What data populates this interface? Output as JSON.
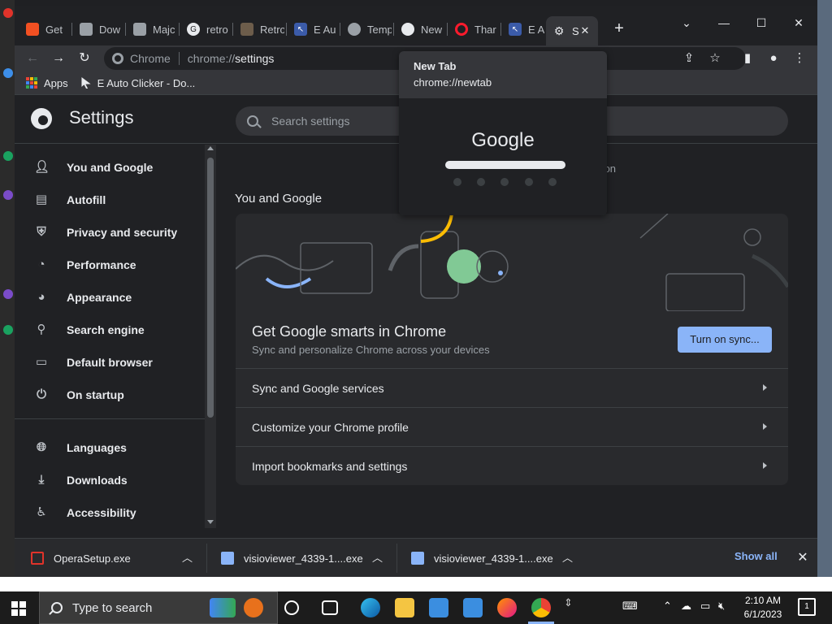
{
  "browser": {
    "tabs": [
      {
        "label": "Get",
        "color": "#f25022"
      },
      {
        "label": "Dow",
        "color": "#9aa0a6"
      },
      {
        "label": "Majc",
        "color": "#9aa0a6"
      },
      {
        "label": "retro",
        "color": "#e8eaed"
      },
      {
        "label": "Retro",
        "color": "#6d5d4b"
      },
      {
        "label": "E Au",
        "color": "#3b5ba9"
      },
      {
        "label": "Temp",
        "color": "#9aa0a6"
      },
      {
        "label": "New",
        "color": "#e8eaed"
      },
      {
        "label": "Thar",
        "color": "#ff1b2d"
      },
      {
        "label": "E Au",
        "color": "#3b5ba9"
      },
      {
        "label": "S",
        "color": "#e8eaed"
      }
    ],
    "omnibox": {
      "scheme_label": "Chrome",
      "url_prefix": "chrome://",
      "url_path": "settings"
    },
    "bookmarks": [
      {
        "label": "Apps"
      },
      {
        "label": "E Auto Clicker - Do..."
      }
    ],
    "hover_card": {
      "title": "New Tab",
      "url": "chrome://newtab",
      "thumbnail_logo": "Google"
    }
  },
  "settings": {
    "title": "Settings",
    "search_placeholder": "Search settings",
    "sidebar": [
      {
        "label": "You and Google",
        "icon": "person-icon"
      },
      {
        "label": "Autofill",
        "icon": "clipboard-icon"
      },
      {
        "label": "Privacy and security",
        "icon": "shield-icon"
      },
      {
        "label": "Performance",
        "icon": "speedometer-icon"
      },
      {
        "label": "Appearance",
        "icon": "palette-icon"
      },
      {
        "label": "Search engine",
        "icon": "search-icon"
      },
      {
        "label": "Default browser",
        "icon": "browser-icon"
      },
      {
        "label": "On startup",
        "icon": "power-icon"
      },
      {
        "label": "Languages",
        "icon": "globe-icon"
      },
      {
        "label": "Downloads",
        "icon": "download-icon"
      },
      {
        "label": "Accessibility",
        "icon": "accessibility-icon"
      }
    ],
    "partial_text": "anization",
    "section_title": "You and Google",
    "promo": {
      "title": "Get Google smarts in Chrome",
      "subtitle": "Sync and personalize Chrome across your devices",
      "button": "Turn on sync..."
    },
    "rows": [
      {
        "label": "Sync and Google services"
      },
      {
        "label": "Customize your Chrome profile"
      },
      {
        "label": "Import bookmarks and settings"
      }
    ],
    "accent_color": "#8ab4f8"
  },
  "downloads": {
    "items": [
      {
        "name": "OperaSetup.exe"
      },
      {
        "name": "visioviewer_4339-1....exe"
      },
      {
        "name": "visioviewer_4339-1....exe"
      }
    ],
    "show_all": "Show all"
  },
  "taskbar": {
    "search_placeholder": "Type to search",
    "time": "2:10 AM",
    "date": "6/1/2023",
    "notification_count": "1"
  }
}
